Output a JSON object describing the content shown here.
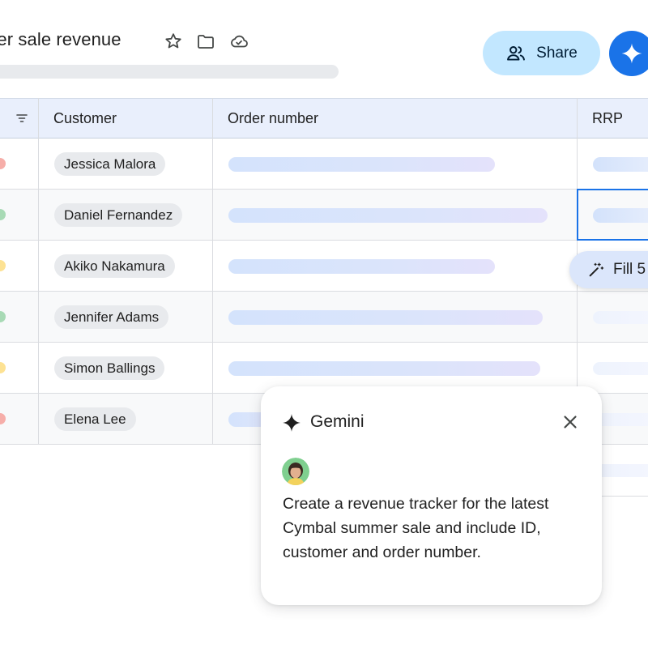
{
  "header": {
    "title": "mer sale revenue",
    "icons": [
      "star-icon",
      "folder-icon",
      "cloud-icon"
    ],
    "share_label": "Share",
    "share_icon": "people-icon",
    "gemini_icon": "gemini-sparkle-icon"
  },
  "table": {
    "columns": [
      "Customer",
      "Order number",
      "RRP"
    ],
    "rows": [
      {
        "customer": "Jessica Malora",
        "status_color": "#f6aea9"
      },
      {
        "customer": "Daniel Fernandez",
        "status_color": "#a8dab5"
      },
      {
        "customer": "Akiko Nakamura",
        "status_color": "#fde293"
      },
      {
        "customer": "Jennifer Adams",
        "status_color": "#a8dab5"
      },
      {
        "customer": "Simon Ballings",
        "status_color": "#fde293"
      },
      {
        "customer": "Elena Lee",
        "status_color": "#f6aea9"
      }
    ]
  },
  "fill_chip": {
    "label": "Fill 5",
    "icon": "magic-wand-icon"
  },
  "gemini_panel": {
    "title": "Gemini",
    "icon": "gemini-sparkle-icon",
    "close_icon": "close-icon",
    "prompt": "Create a revenue tracker for the latest Cymbal summer sale and include ID, customer and order number."
  },
  "colors": {
    "accent": "#1a73e8",
    "share_bg": "#c2e7ff",
    "header_row_bg": "#e9effc"
  }
}
